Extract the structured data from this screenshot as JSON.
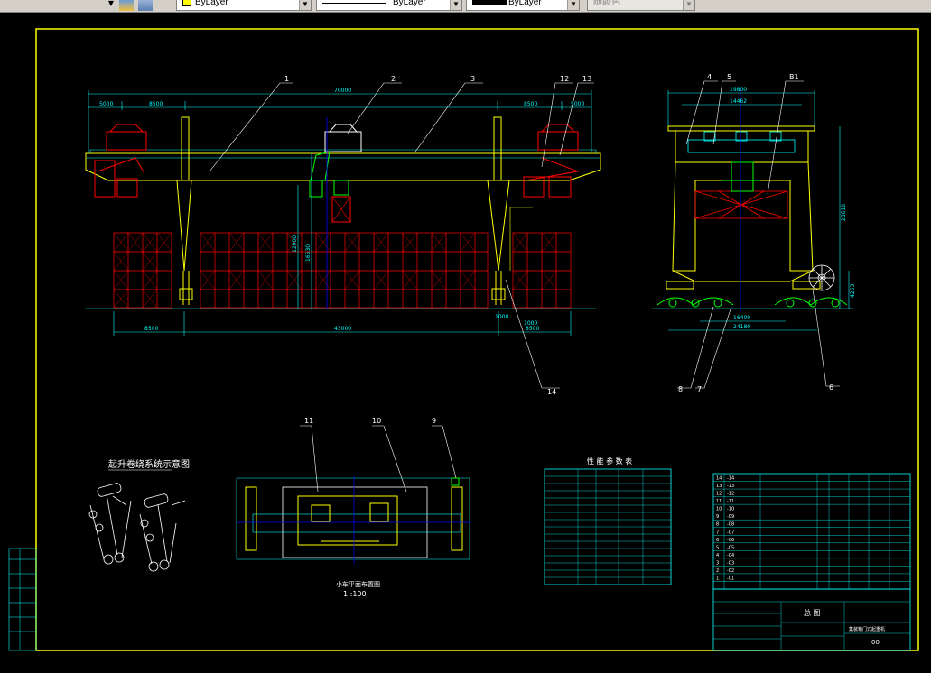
{
  "toolbar": {
    "layer_combo": {
      "value": "ByLayer",
      "swatch": "#ffff00"
    },
    "linetype_combo": {
      "value": "ByLayer"
    },
    "lineweight_combo": {
      "value": "ByLayer"
    },
    "plotstyle_combo": {
      "value": "随颜色"
    }
  },
  "colors": {
    "frame": "#ffff00",
    "dimension": "#00ffff",
    "structure": "#ffff00",
    "hoist": "#ff0000",
    "trolley": "#00ff00",
    "container": "#ff0000",
    "centerline": "#0000ff",
    "leader": "#ffffff"
  },
  "front_view": {
    "dimensions": {
      "overall_span": "70000",
      "left_outer": "5000",
      "left_inner": "8500",
      "right_inner": "8500",
      "right_outer": "5000",
      "height_main": "12900",
      "height_total": "16530",
      "bottom_left": "8500",
      "bottom_span": "43000",
      "bottom_right": "8500",
      "small_left": "1000",
      "small_right": "1000"
    },
    "callouts": [
      "1",
      "2",
      "3",
      "12",
      "13",
      "14"
    ]
  },
  "side_view": {
    "dimensions": {
      "top_width": "19800",
      "inner_width": "14462",
      "height": "28610",
      "base_width_1": "16400",
      "base_width_2": "24180",
      "side_small": "4263"
    },
    "callouts": [
      "4",
      "5",
      "B1",
      "8",
      "7",
      "6"
    ]
  },
  "plan_view": {
    "title": "小车平面布置图",
    "scale": "1 :100",
    "callouts": [
      "11",
      "10",
      "9"
    ]
  },
  "rope_diagram": {
    "title": "起升卷绕系统示意图"
  },
  "parameter_table": {
    "title": "性 能 参 数 表"
  },
  "title_block": {
    "drawing_name": "总 图",
    "product_name": "集装箱门式起重机",
    "drawing_no": "00"
  },
  "parts_list": {
    "rows": [
      {
        "no": "14",
        "code": "-14"
      },
      {
        "no": "13",
        "code": "-13"
      },
      {
        "no": "12",
        "code": "-12"
      },
      {
        "no": "11",
        "code": "-11"
      },
      {
        "no": "10",
        "code": "-10"
      },
      {
        "no": "9",
        "code": "-09"
      },
      {
        "no": "8",
        "code": "-08"
      },
      {
        "no": "7",
        "code": "-07"
      },
      {
        "no": "6",
        "code": "-06"
      },
      {
        "no": "5",
        "code": "-05"
      },
      {
        "no": "4",
        "code": "-04"
      },
      {
        "no": "3",
        "code": "-03"
      },
      {
        "no": "2",
        "code": "-02"
      },
      {
        "no": "1",
        "code": "-01"
      }
    ]
  }
}
